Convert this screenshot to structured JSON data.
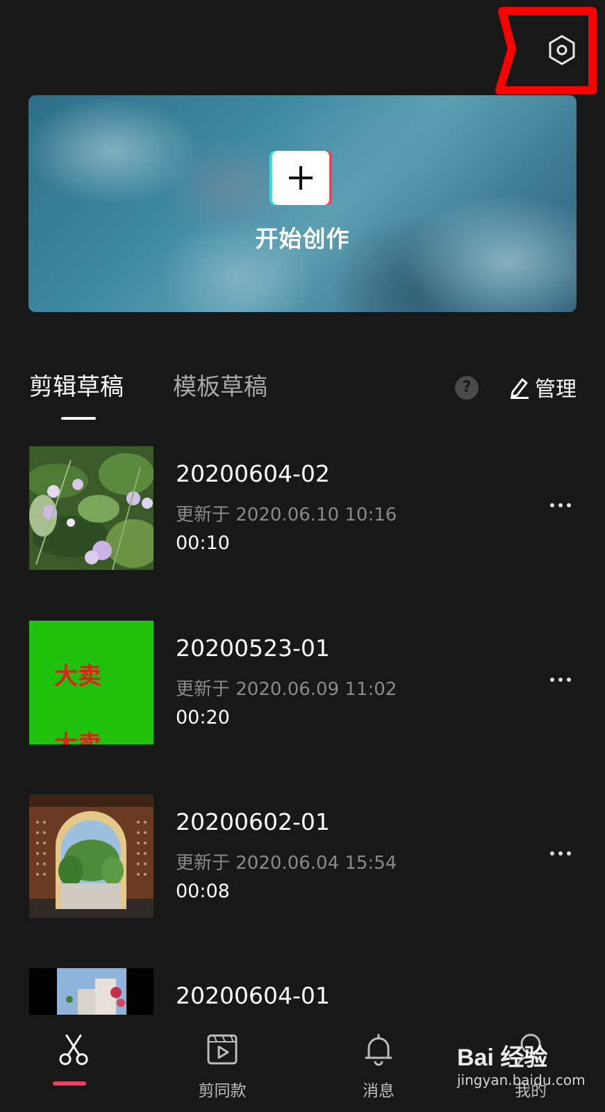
{
  "banner": {
    "label": "开始创作"
  },
  "tabs": [
    {
      "label": "剪辑草稿",
      "active": true
    },
    {
      "label": "模板草稿",
      "active": false
    }
  ],
  "help": {
    "label": "?"
  },
  "manage": {
    "label": "管理"
  },
  "drafts": [
    {
      "title": "20200604-02",
      "updated": "更新于 2020.06.10 10:16",
      "duration": "00:10"
    },
    {
      "title": "20200523-01",
      "updated": "更新于 2020.06.09 11:02",
      "duration": "00:20",
      "thumb_text": [
        "大卖",
        "大卖"
      ]
    },
    {
      "title": "20200602-01",
      "updated": "更新于 2020.06.04 15:54",
      "duration": "00:08"
    },
    {
      "title": "20200604-01"
    }
  ],
  "nav": [
    {
      "label": "",
      "icon": "scissors-icon",
      "active": true
    },
    {
      "label": "剪同款",
      "icon": "template-video-icon",
      "active": false
    },
    {
      "label": "消息",
      "icon": "bell-icon",
      "active": false
    },
    {
      "label": "我的",
      "icon": "user-icon",
      "active": false
    }
  ],
  "watermark": {
    "logo": "Bai 经验",
    "url": "jingyan.baidu.com"
  },
  "colors": {
    "background": "#181818",
    "accent": "#f0405f",
    "annotation": "#ff0000",
    "cyan": "#2ee6e0",
    "pink": "#ff3b5c"
  }
}
